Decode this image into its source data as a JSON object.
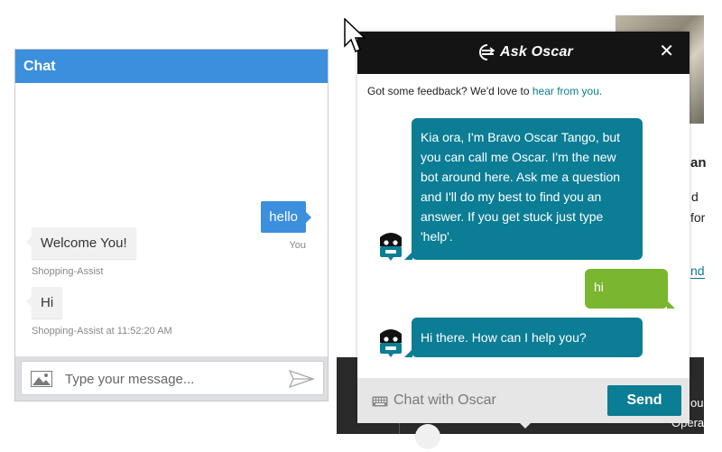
{
  "left_chat": {
    "header_title": "Chat",
    "messages": [
      {
        "from": "user",
        "text": "hello",
        "meta": "You"
      },
      {
        "from": "bot",
        "text": "Welcome You!",
        "meta": "Shopping-Assist"
      },
      {
        "from": "bot",
        "text": "Hi",
        "meta": "Shopping-Assist at 11:52:20 AM"
      }
    ],
    "input_placeholder": "Type your message..."
  },
  "oscar": {
    "title": "Ask Oscar",
    "close_glyph": "✕",
    "feedback_text": "Got some feedback? We'd love to ",
    "feedback_link": "hear from you.",
    "messages": [
      {
        "from": "bot",
        "text": "Kia ora, I'm Bravo Oscar Tango, but you can call me Oscar. I'm the new bot around here. Ask me a question and I'll do my best to find you an answer. If you get stuck just type 'help'."
      },
      {
        "from": "user",
        "text": "hi"
      },
      {
        "from": "bot",
        "text": "Hi there. How can I help you?"
      }
    ],
    "input_placeholder": "Chat with Oscar",
    "send_label": "Send"
  },
  "background_page": {
    "fragments": [
      "an",
      "d",
      "for",
      "nd"
    ],
    "footer_fragments": [
      "ou",
      "Opera"
    ]
  },
  "colors": {
    "left_header": "#3b8fdd",
    "oscar_teal": "#0b7d95",
    "oscar_green": "#7ab630",
    "oscar_header": "#141414"
  },
  "icons": [
    "image-icon",
    "send-arrow-icon",
    "oscar-logo-icon",
    "close-icon",
    "robot-avatar-icon",
    "keyboard-icon",
    "mouse-cursor-icon"
  ]
}
